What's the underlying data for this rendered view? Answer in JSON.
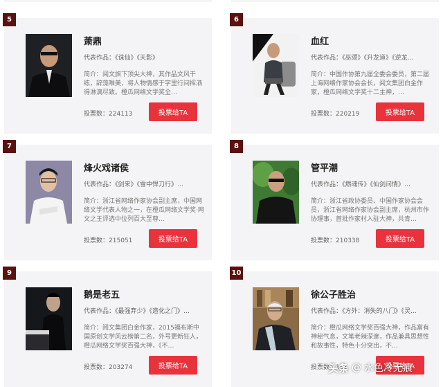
{
  "button_label": "投票给TA",
  "votes_prefix": "投票数：",
  "cards": [
    {
      "rank": "5",
      "name": "萧鼎",
      "works": "代表作品：《诛仙》《天影》",
      "intro": "简介：阅文旗下顶尖大神，其作品文风干练，辞藻唯美，将人物情感于字里行间挥洒得淋漓尽致。橙瓜网络文学奖全…",
      "votes": "224113"
    },
    {
      "rank": "6",
      "name": "血红",
      "works": "代表作品：《巫颂》《升龙道》《逆龙…",
      "intro": "简介：中国作协第九届全委会委员，第二届上海网络作家协会会长，阅文集团白金作家，橙瓜网络文学奖十二主神，…",
      "votes": "220219"
    },
    {
      "rank": "7",
      "name": "烽火戏诸侯",
      "works": "代表作品：《剑来》《雪中悍刀行》…",
      "intro": "简介：浙江省网络作家协会副主席，中国网络文学代表人物之一，在橙瓜网络文学奖·网文之王评选中位列百大至尊…",
      "votes": "215051"
    },
    {
      "rank": "8",
      "name": "管平潮",
      "works": "代表作品：《燃魂传》《仙剑问情》…",
      "intro": "简介：浙江省政协委员、中国作家协会会员，浙江省网络作家协会副主席，杭州市作协理事，首批作家村入驻大神，共青…",
      "votes": "210338"
    },
    {
      "rank": "9",
      "name": "鹅是老五",
      "works": "代表作品：《最强弃少》《造化之门》…",
      "intro": "简介：阅文集团白金作家，2015福布斯中国原创文学风云榜第二名，外号更新狂人，橙瓜网络文学奖百强大神，《不…",
      "votes": "203274"
    },
    {
      "rank": "10",
      "name": "徐公子胜治",
      "works": "代表作品：《方外：消失的八门》《灵…",
      "intro": "简介：橙瓜网络文学奖百强大神，作品富有神秘气息，文笔老辣深邃，作品兼具思想性和故事性，特色十分突出，不…",
      "votes": "191"
    }
  ],
  "watermark": {
    "logo": "头条",
    "at": "@",
    "account": "水色冷无痕"
  }
}
